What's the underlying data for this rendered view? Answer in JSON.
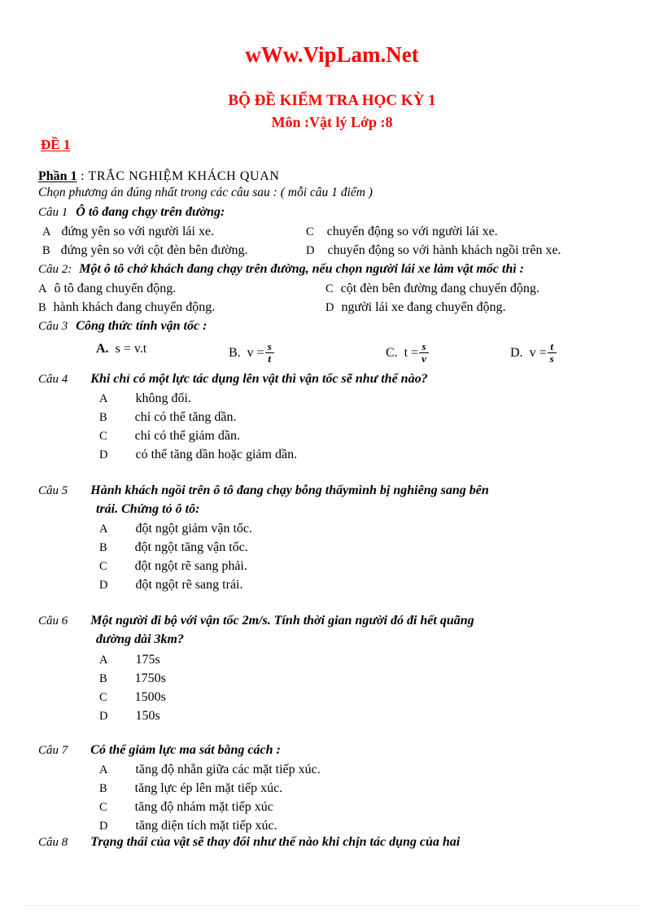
{
  "header": {
    "site": "wWw.VipLam.Net",
    "exam_title": "BỘ ĐỀ KIỂM TRA HỌC KỲ 1",
    "subject_line": "Môn :Vật lý  Lớp :8",
    "de_label": "ĐỀ 1"
  },
  "part": {
    "key": "Phần 1",
    "value": " : TRẮC  NGHIỆM  KHÁCH  QUAN",
    "instruction": "Chọn phương án đúng nhất trong các  câu sau : ( mỗi câu 1 điểm )"
  },
  "questions": [
    {
      "label": "Câu 1",
      "text": "Ô tô đang chạy trên đường:",
      "options": [
        {
          "letter": "A",
          "text": "đứng yên so với người lái  xe."
        },
        {
          "letter": "B",
          "text": "đứng yên so với cột đèn bên đường."
        },
        {
          "letter": "C",
          "text": "chuyển động so với người lái xe."
        },
        {
          "letter": "D",
          "text": "chuyển động so với hành khách ngồi trên xe."
        }
      ]
    },
    {
      "label": "Câu 2:",
      "text": "Một ô tô chở khách đang chạy trên đường, nếu chọn người lái xe làm vật mốc thì :",
      "options": [
        {
          "letter": "A",
          "text": "ô tô đang chuyển động."
        },
        {
          "letter": "B",
          "text": "hành khách đang chuyển động."
        },
        {
          "letter": "C",
          "text": "cột đèn bên đường đang chuyển động."
        },
        {
          "letter": "D",
          "text": "người lái  xe đang chuyển động."
        }
      ]
    },
    {
      "label": "Câu 3",
      "text": "Công thức tính vận tốc :",
      "formulas": [
        {
          "letter": "A.",
          "lhs": "s = v.t",
          "num": "",
          "den": ""
        },
        {
          "letter": "B.",
          "lhs": "v =",
          "num": "s",
          "den": "t"
        },
        {
          "letter": "C.",
          "lhs": "t =",
          "num": "s",
          "den": "v"
        },
        {
          "letter": "D.",
          "lhs": "v =",
          "num": "t",
          "den": "s"
        }
      ]
    },
    {
      "label": "Câu 4",
      "text": "Khi chỉ có một lực tác dụng lên vật thì vận tốc sẽ như thế nào?",
      "options": [
        {
          "letter": "A",
          "text": "không đổi."
        },
        {
          "letter": "B",
          "text": "chỉ có thể tăng dần."
        },
        {
          "letter": "C",
          "text": "chỉ có thể giảm  dần."
        },
        {
          "letter": "D",
          "text": "có thể tăng dần hoặc giảm  dần."
        }
      ]
    },
    {
      "label": "Câu 5",
      "text_line1": "Hành khách ngồi trên ô tô đang chạy bỗng thấymình bị nghiêng sang bên",
      "text_line2": "trái. Chứng tỏ ô tô:",
      "options": [
        {
          "letter": "A",
          "text": "đột ngột giảm  vận tốc."
        },
        {
          "letter": "B",
          "text": "đột ngột tăng vận tốc."
        },
        {
          "letter": "C",
          "text": "đột ngột rẽ sang phải."
        },
        {
          "letter": "D",
          "text": "đột ngột rẽ sang trái."
        }
      ]
    },
    {
      "label": "Câu 6",
      "text_line1": "Một người đi bộ với vận tốc  2m/s. Tính thời gian người đó đi hết quãng",
      "text_line2": "đường dài 3km?",
      "options": [
        {
          "letter": "A",
          "text": "175s"
        },
        {
          "letter": "B",
          "text": "1750s"
        },
        {
          "letter": "C",
          "text": "1500s"
        },
        {
          "letter": "D",
          "text": "150s"
        }
      ]
    },
    {
      "label": "Câu 7",
      "text": "Có thể giảm lực ma sát bằng cách :",
      "options": [
        {
          "letter": "A",
          "text": "tăng độ nhẵn giữa  các mặt tiếp xúc."
        },
        {
          "letter": "B",
          "text": "tăng lực ép lên mặt tiếp xúc."
        },
        {
          "letter": "C",
          "text": "tăng độ nhám mặt tiếp xúc"
        },
        {
          "letter": "D",
          "text": "tăng diện tích mặt tiếp xúc."
        }
      ]
    },
    {
      "label": "Câu 8",
      "text": "Trạng thái của vật sẽ thay đổi như thế nào khi chịn tác dụng của hai"
    }
  ],
  "colors": {
    "accent_red": "#ff0000",
    "text_black": "#000000",
    "page_background": "#ffffff"
  }
}
